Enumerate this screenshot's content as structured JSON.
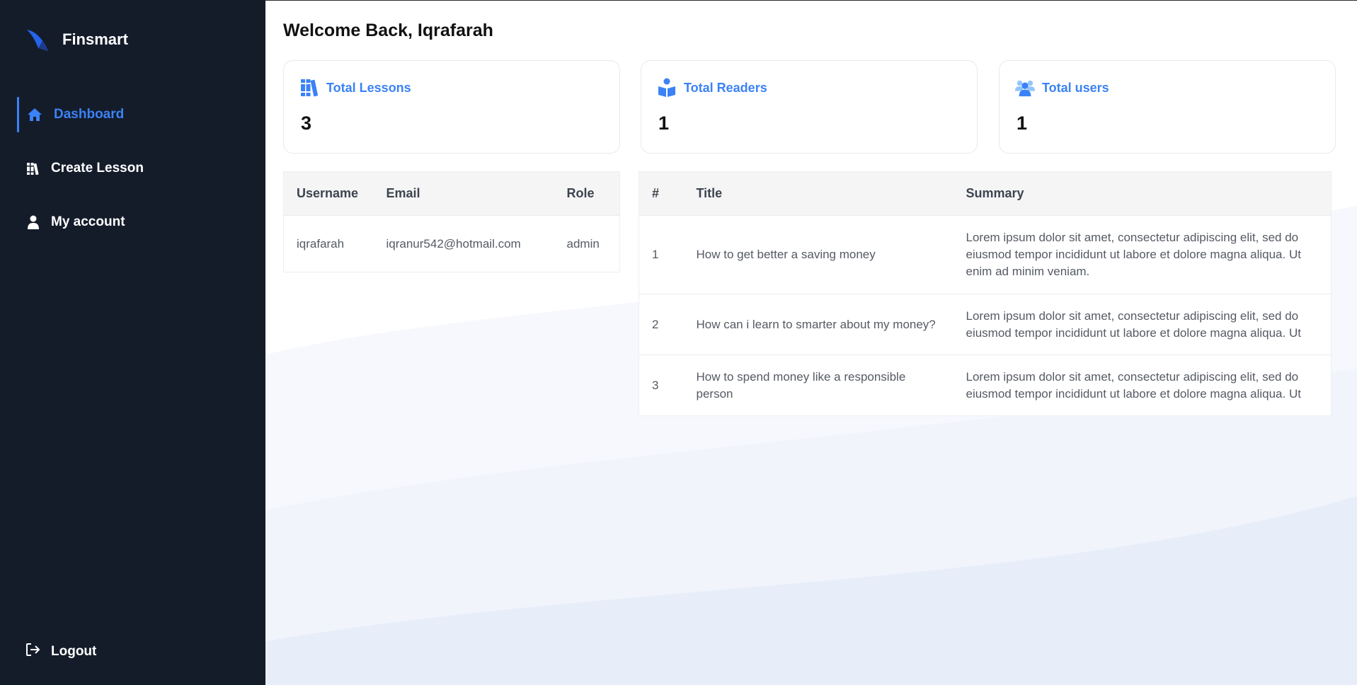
{
  "brand": {
    "name": "Finsmart",
    "logo_icon": "fin-logo-icon",
    "accent": "#3b82f6"
  },
  "sidebar": {
    "items": [
      {
        "label": "Dashboard",
        "icon": "home-icon",
        "active": true
      },
      {
        "label": "Create Lesson",
        "icon": "books-icon",
        "active": false
      },
      {
        "label": "My account",
        "icon": "user-icon",
        "active": false
      }
    ],
    "logout": {
      "label": "Logout",
      "icon": "logout-icon"
    }
  },
  "header": {
    "welcome": "Welcome Back, Iqrafarah"
  },
  "stats": [
    {
      "title": "Total Lessons",
      "value": "3",
      "icon": "books-icon"
    },
    {
      "title": "Total Readers",
      "value": "1",
      "icon": "reader-icon"
    },
    {
      "title": "Total users",
      "value": "1",
      "icon": "users-icon"
    }
  ],
  "users_table": {
    "headers": [
      "Username",
      "Email",
      "Role"
    ],
    "rows": [
      [
        "iqrafarah",
        "iqranur542@hotmail.com",
        "admin"
      ]
    ]
  },
  "lessons_table": {
    "headers": [
      "#",
      "Title",
      "Summary"
    ],
    "rows": [
      [
        "1",
        "How to get better a saving money",
        "Lorem ipsum dolor sit amet, consectetur adipiscing elit, sed do eiusmod tempor incididunt ut labore et dolore magna aliqua. Ut enim ad minim veniam."
      ],
      [
        "2",
        "How can i learn to smarter about my money?",
        "Lorem ipsum dolor sit amet, consectetur adipiscing elit, sed do eiusmod tempor incididunt ut labore et dolore magna aliqua. Ut"
      ],
      [
        "3",
        "How to spend money like a responsible person",
        "Lorem ipsum dolor sit amet, consectetur adipiscing elit, sed do eiusmod tempor incididunt ut labore et dolore magna aliqua. Ut"
      ]
    ]
  },
  "colors": {
    "sidebar_bg": "#141c2a",
    "accent": "#3b82f6",
    "header_bg": "#f5f5f5"
  }
}
